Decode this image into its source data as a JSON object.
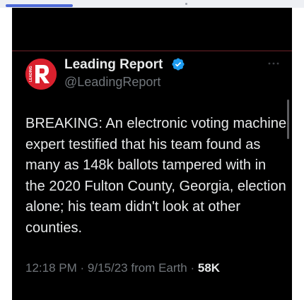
{
  "tweet": {
    "author": {
      "display_name": "Leading Report",
      "handle": "@LeadingReport",
      "verified": true,
      "avatar_letter": "R",
      "avatar_side_text": "LEADING",
      "brand_color": "#d9202d"
    },
    "text": "BREAKING: An electronic voting machine expert testified that his team found as many as 148k ballots tampered with in the 2020 Fulton County, Georgia, election alone; his team didn't look at other counties.",
    "time": "12:18 PM",
    "date": "9/15/23",
    "source": "from Earth",
    "separator": "·",
    "views": "58K",
    "colors": {
      "background": "#000000",
      "text": "#e7e9ea",
      "secondary_text": "#71767b",
      "verified_badge": "#1d9bf0"
    }
  }
}
